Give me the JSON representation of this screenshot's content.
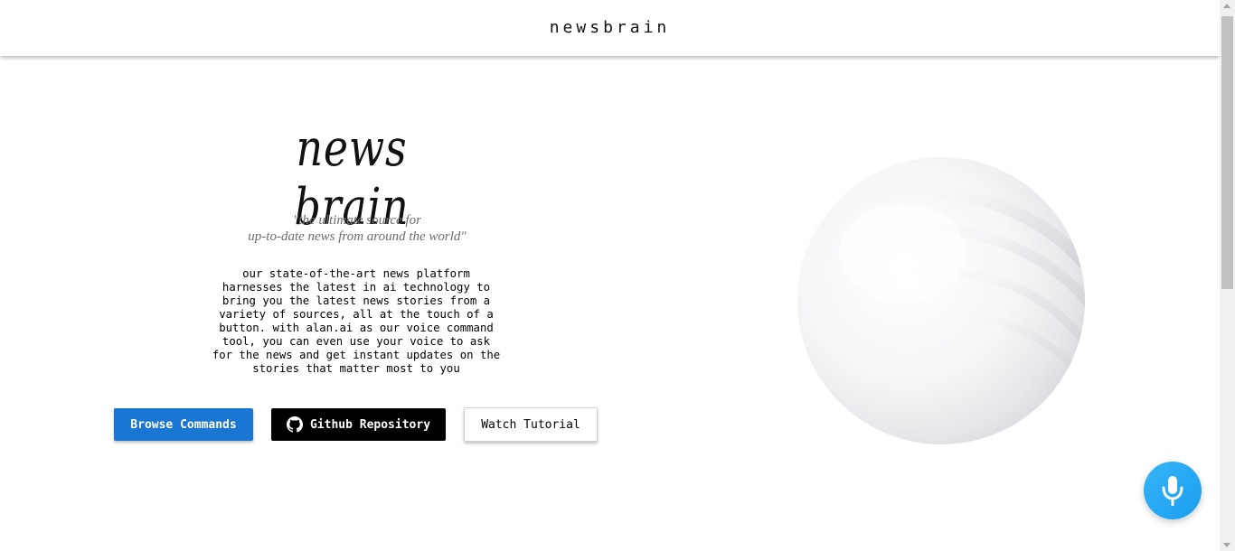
{
  "header": {
    "brand": "newsbrain"
  },
  "hero": {
    "title": "news brain",
    "tagline_line1": "\"the ultimate source for",
    "tagline_line2": "up-to-date news from around the world\"",
    "description": "our state-of-the-art news platform\nharnesses the latest in ai technology to\nbring you the latest news stories from a\nvariety of sources, all at the touch of a\nbutton. with alan.ai as our voice command\ntool, you can even use your voice to ask\nfor the news and get instant updates on the\nstories that matter most to you"
  },
  "buttons": {
    "browse_commands": "Browse Commands",
    "github_repository": "Github Repository",
    "watch_tutorial": "Watch Tutorial"
  },
  "icons": {
    "github": "github-icon",
    "microphone": "microphone-icon",
    "sphere": "white-sphere-graphic"
  },
  "colors": {
    "primary_button": "#1976d2",
    "github_button": "#000000",
    "mic_button": "#1fa5f3"
  }
}
